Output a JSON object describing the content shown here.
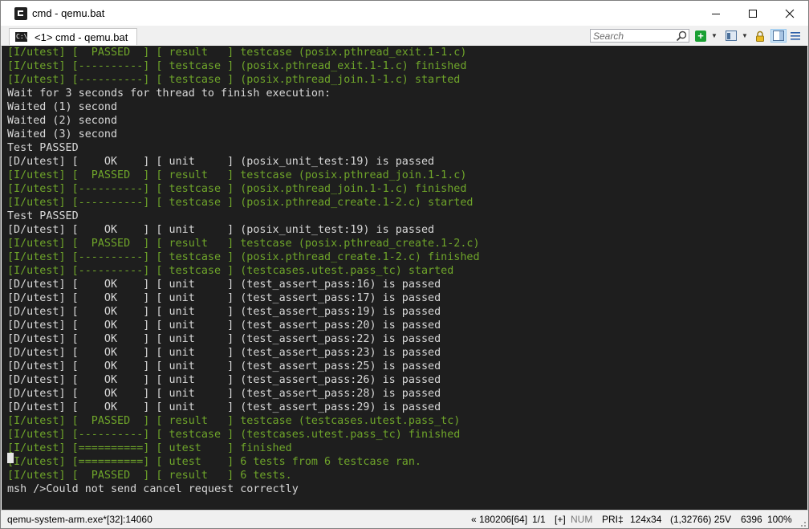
{
  "window": {
    "title": "cmd - qemu.bat"
  },
  "controls": {
    "minimize": "─",
    "maximize": "☐",
    "close": "✕"
  },
  "tab": {
    "label": "<1> cmd - qemu.bat",
    "icon": "cmd-icon"
  },
  "toolbar": {
    "search_placeholder": "Search"
  },
  "console": {
    "lines": [
      {
        "text": "[I/utest] [  PASSED  ] [ result   ] testcase (posix.pthread_exit.1-1.c)",
        "color": "#6fa52a"
      },
      {
        "text": "[I/utest] [----------] [ testcase ] (posix.pthread_exit.1-1.c) finished",
        "color": "#6fa52a"
      },
      {
        "text": "[I/utest] [----------] [ testcase ] (posix.pthread_join.1-1.c) started",
        "color": "#6fa52a"
      },
      {
        "text": "Wait for 3 seconds for thread to finish execution:",
        "color": "#d8d8d8"
      },
      {
        "text": "Waited (1) second",
        "color": "#d8d8d8"
      },
      {
        "text": "Waited (2) second",
        "color": "#d8d8d8"
      },
      {
        "text": "Waited (3) second",
        "color": "#d8d8d8"
      },
      {
        "text": "Test PASSED",
        "color": "#d8d8d8"
      },
      {
        "text": "[D/utest] [    OK    ] [ unit     ] (posix_unit_test:19) is passed",
        "color": "#d8d8d8"
      },
      {
        "text": "[I/utest] [  PASSED  ] [ result   ] testcase (posix.pthread_join.1-1.c)",
        "color": "#6fa52a"
      },
      {
        "text": "[I/utest] [----------] [ testcase ] (posix.pthread_join.1-1.c) finished",
        "color": "#6fa52a"
      },
      {
        "text": "[I/utest] [----------] [ testcase ] (posix.pthread_create.1-2.c) started",
        "color": "#6fa52a"
      },
      {
        "text": "Test PASSED",
        "color": "#d8d8d8"
      },
      {
        "text": "[D/utest] [    OK    ] [ unit     ] (posix_unit_test:19) is passed",
        "color": "#d8d8d8"
      },
      {
        "text": "[I/utest] [  PASSED  ] [ result   ] testcase (posix.pthread_create.1-2.c)",
        "color": "#6fa52a"
      },
      {
        "text": "[I/utest] [----------] [ testcase ] (posix.pthread_create.1-2.c) finished",
        "color": "#6fa52a"
      },
      {
        "text": "[I/utest] [----------] [ testcase ] (testcases.utest.pass_tc) started",
        "color": "#6fa52a"
      },
      {
        "text": "[D/utest] [    OK    ] [ unit     ] (test_assert_pass:16) is passed",
        "color": "#d8d8d8"
      },
      {
        "text": "[D/utest] [    OK    ] [ unit     ] (test_assert_pass:17) is passed",
        "color": "#d8d8d8"
      },
      {
        "text": "[D/utest] [    OK    ] [ unit     ] (test_assert_pass:19) is passed",
        "color": "#d8d8d8"
      },
      {
        "text": "[D/utest] [    OK    ] [ unit     ] (test_assert_pass:20) is passed",
        "color": "#d8d8d8"
      },
      {
        "text": "[D/utest] [    OK    ] [ unit     ] (test_assert_pass:22) is passed",
        "color": "#d8d8d8"
      },
      {
        "text": "[D/utest] [    OK    ] [ unit     ] (test_assert_pass:23) is passed",
        "color": "#d8d8d8"
      },
      {
        "text": "[D/utest] [    OK    ] [ unit     ] (test_assert_pass:25) is passed",
        "color": "#d8d8d8"
      },
      {
        "text": "[D/utest] [    OK    ] [ unit     ] (test_assert_pass:26) is passed",
        "color": "#d8d8d8"
      },
      {
        "text": "[D/utest] [    OK    ] [ unit     ] (test_assert_pass:28) is passed",
        "color": "#d8d8d8"
      },
      {
        "text": "[D/utest] [    OK    ] [ unit     ] (test_assert_pass:29) is passed",
        "color": "#d8d8d8"
      },
      {
        "text": "[I/utest] [  PASSED  ] [ result   ] testcase (testcases.utest.pass_tc)",
        "color": "#6fa52a"
      },
      {
        "text": "[I/utest] [----------] [ testcase ] (testcases.utest.pass_tc) finished",
        "color": "#6fa52a"
      },
      {
        "text": "[I/utest] [==========] [ utest    ] finished",
        "color": "#6fa52a"
      },
      {
        "text": "[I/utest] [==========] [ utest    ] 6 tests from 6 testcase ran.",
        "color": "#6fa52a"
      },
      {
        "text": "[I/utest] [  PASSED  ] [ result   ] 6 tests.",
        "color": "#6fa52a"
      },
      {
        "text": "msh />Could not send cancel request correctly",
        "color": "#d8d8d8"
      }
    ]
  },
  "status": {
    "process": "qemu-system-arm.exe*[32]:14060",
    "position": "« 180206[64]",
    "page": "1/1",
    "insert": "[+]",
    "num": "NUM",
    "priority": "PRI‡",
    "size": "124x34",
    "coords": "(1,32766) 25V",
    "memory": "6396",
    "zoom": "100%"
  }
}
